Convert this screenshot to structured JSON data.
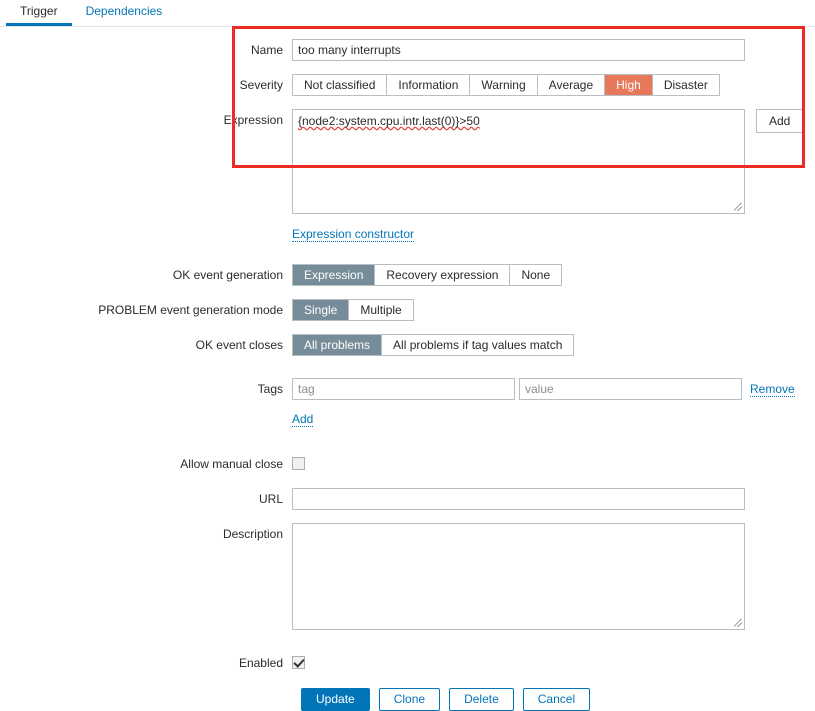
{
  "tabs": [
    {
      "label": "Trigger",
      "active": true
    },
    {
      "label": "Dependencies",
      "active": false
    }
  ],
  "form": {
    "name": {
      "label": "Name",
      "value": "too many interrupts",
      "placeholder": ""
    },
    "severity": {
      "label": "Severity",
      "options": [
        "Not classified",
        "Information",
        "Warning",
        "Average",
        "High",
        "Disaster"
      ],
      "selected": "High",
      "selected_color": "#e8785a"
    },
    "expression": {
      "label": "Expression",
      "value": "{node2:system.cpu.intr.last(0)}>50",
      "add_button": "Add",
      "constructor_link": "Expression constructor"
    },
    "ok_event_generation": {
      "label": "OK event generation",
      "options": [
        "Expression",
        "Recovery expression",
        "None"
      ],
      "selected": "Expression"
    },
    "problem_event_generation_mode": {
      "label": "PROBLEM event generation mode",
      "options": [
        "Single",
        "Multiple"
      ],
      "selected": "Single"
    },
    "ok_event_closes": {
      "label": "OK event closes",
      "options": [
        "All problems",
        "All problems if tag values match"
      ],
      "selected": "All problems"
    },
    "tags": {
      "label": "Tags",
      "rows": [
        {
          "tag_value": "",
          "tag_placeholder": "tag",
          "value_value": "",
          "value_placeholder": "value",
          "remove_label": "Remove"
        }
      ],
      "add_label": "Add"
    },
    "allow_manual_close": {
      "label": "Allow manual close",
      "checked": false
    },
    "url": {
      "label": "URL",
      "value": "",
      "placeholder": ""
    },
    "description": {
      "label": "Description",
      "value": "",
      "placeholder": ""
    },
    "enabled": {
      "label": "Enabled",
      "checked": true
    }
  },
  "footer": {
    "update": "Update",
    "clone": "Clone",
    "delete": "Delete",
    "cancel": "Cancel"
  },
  "colors": {
    "accent_blue": "#0275b8",
    "selected_gray": "#768d99",
    "high_severity": "#e8785a",
    "annotation_red": "#ee2a23"
  }
}
